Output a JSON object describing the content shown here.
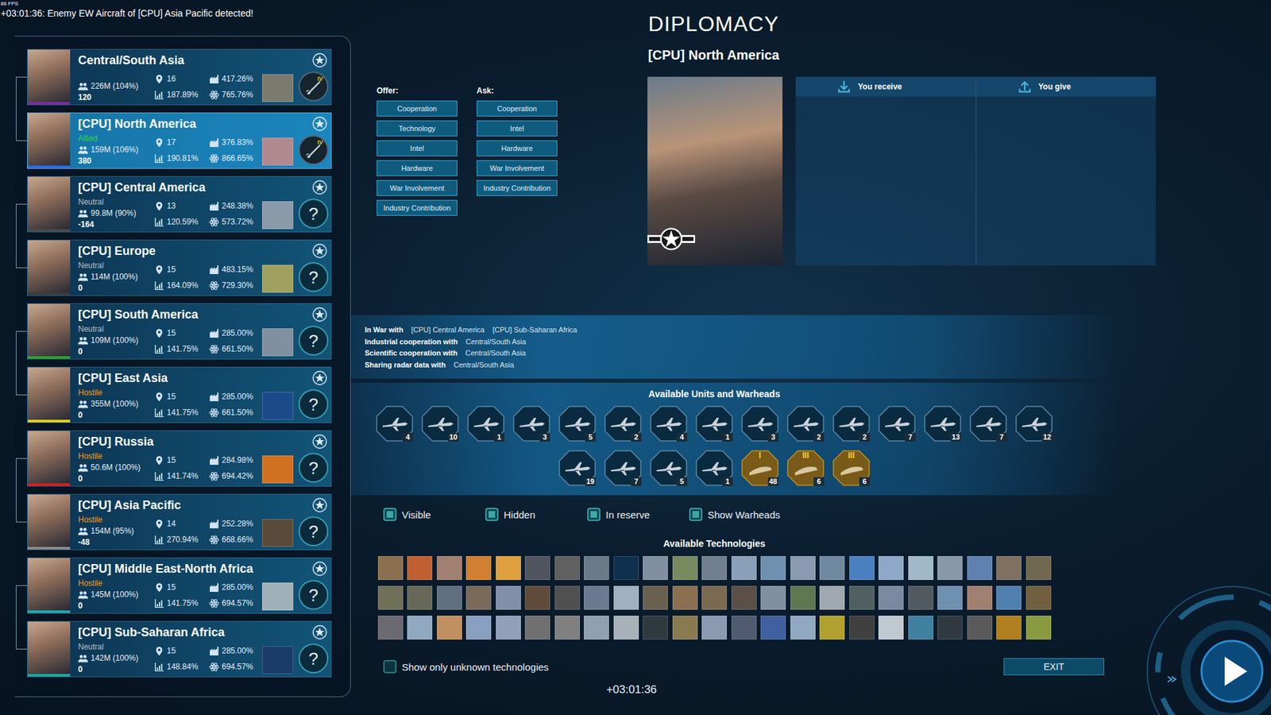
{
  "hud": {
    "fps": "86 FPS",
    "log": "+03:01:36: Enemy EW Aircraft of [CPU] Asia Pacific detected!"
  },
  "title": "DIPLOMACY",
  "countries": [
    {
      "name": "Central/South Asia",
      "status": null,
      "status_color": null,
      "population": "226M (104%)",
      "score": "120",
      "regions": "16",
      "growth": "187.89%",
      "industry": "417.26%",
      "research": "765.76%",
      "selected": false,
      "color": "#7a2c9e",
      "thumb_color": "#7a7a70",
      "badge": {
        "kind": "rank",
        "text": "IV"
      }
    },
    {
      "name": "[CPU] North America",
      "status": "Allied",
      "status_color": "#3ad24a",
      "population": "159M (106%)",
      "score": "380",
      "regions": "17",
      "growth": "190.81%",
      "industry": "376.83%",
      "research": "866.65%",
      "selected": true,
      "color": "#2a6ae0",
      "thumb_color": "#b08890",
      "badge": {
        "kind": "rank",
        "text": "IV"
      }
    },
    {
      "name": "[CPU] Central America",
      "status": "Neutral",
      "status_color": "#b4c0c8",
      "population": "99.8M (90%)",
      "score": "-164",
      "regions": "13",
      "growth": "120.59%",
      "industry": "248.38%",
      "research": "573.72%",
      "selected": false,
      "color": "#4a4a4a",
      "thumb_color": "#8a9aa8",
      "badge": {
        "kind": "unknown",
        "text": "?"
      }
    },
    {
      "name": "[CPU] Europe",
      "status": "Neutral",
      "status_color": "#b4c0c8",
      "population": "114M (100%)",
      "score": "0",
      "regions": "15",
      "growth": "164.09%",
      "industry": "483.15%",
      "research": "729.30%",
      "selected": false,
      "color": "#3c3c3c",
      "thumb_color": "#a0a060",
      "badge": {
        "kind": "unknown",
        "text": "?"
      }
    },
    {
      "name": "[CPU] South America",
      "status": "Neutral",
      "status_color": "#b4c0c8",
      "population": "109M (100%)",
      "score": "0",
      "regions": "15",
      "growth": "141.75%",
      "industry": "285.00%",
      "research": "661.50%",
      "selected": false,
      "color": "#2fa02f",
      "thumb_color": "#8090a0",
      "badge": {
        "kind": "unknown",
        "text": "?"
      }
    },
    {
      "name": "[CPU] East Asia",
      "status": "Hostile",
      "status_color": "#f0a020",
      "population": "355M (100%)",
      "score": "0",
      "regions": "15",
      "growth": "141.75%",
      "industry": "285.00%",
      "research": "661.50%",
      "selected": false,
      "color": "#e0d020",
      "thumb_color": "#1a4a8a",
      "badge": {
        "kind": "unknown",
        "text": "?"
      }
    },
    {
      "name": "[CPU] Russia",
      "status": "Hostile",
      "status_color": "#f0a020",
      "population": "50.6M (100%)",
      "score": "0",
      "regions": "15",
      "growth": "141.74%",
      "industry": "284.98%",
      "research": "694.42%",
      "selected": false,
      "color": "#d02020",
      "thumb_color": "#d07020",
      "badge": {
        "kind": "unknown",
        "text": "?"
      }
    },
    {
      "name": "[CPU] Asia Pacific",
      "status": "Hostile",
      "status_color": "#f0a020",
      "population": "154M (95%)",
      "score": "-48",
      "regions": "14",
      "growth": "270.94%",
      "industry": "252.28%",
      "research": "668.66%",
      "selected": false,
      "color": "#8a8a8a",
      "thumb_color": "#5a4a3a",
      "badge": {
        "kind": "unknown",
        "text": "?"
      }
    },
    {
      "name": "[CPU] Middle East-North Africa",
      "status": "Hostile",
      "status_color": "#f0a020",
      "population": "145M (100%)",
      "score": "0",
      "regions": "15",
      "growth": "141.75%",
      "industry": "285.00%",
      "research": "694.57%",
      "selected": false,
      "color": "#20a8b0",
      "thumb_color": "#a0b0b8",
      "badge": {
        "kind": "unknown",
        "text": "?"
      }
    },
    {
      "name": "[CPU] Sub-Saharan Africa",
      "status": "Neutral",
      "status_color": "#b4c0c8",
      "population": "142M (100%)",
      "score": "0",
      "regions": "15",
      "growth": "148.84%",
      "industry": "285.00%",
      "research": "694.57%",
      "selected": false,
      "color": "#1aa6a0",
      "thumb_color": "#1a3a6a",
      "badge": {
        "kind": "unknown",
        "text": "?"
      }
    }
  ],
  "selected_country": {
    "name": "[CPU] North America"
  },
  "offer": {
    "label": "Offer:",
    "buttons": [
      "Cooperation",
      "Technology",
      "Intel",
      "Hardware",
      "War Involvement",
      "Industry Contribution"
    ]
  },
  "ask": {
    "label": "Ask:",
    "buttons": [
      "Cooperation",
      "Intel",
      "Hardware",
      "War Involvement",
      "Industry Contribution"
    ]
  },
  "trade": {
    "receive": "You receive",
    "give": "You give"
  },
  "relations": [
    {
      "label": "In War with",
      "values": [
        "[CPU] Central America",
        "[CPU] Sub-Saharan Africa"
      ]
    },
    {
      "label": "Industrial cooperation with",
      "values": [
        "Central/South Asia"
      ]
    },
    {
      "label": "Scientific cooperation with",
      "values": [
        "Central/South Asia"
      ]
    },
    {
      "label": "Sharing radar data with",
      "values": [
        "Central/South Asia"
      ]
    }
  ],
  "units": {
    "title": "Available Units and Warheads",
    "items": [
      {
        "kind": "unit",
        "tier": null,
        "count": "4"
      },
      {
        "kind": "unit",
        "tier": null,
        "count": "10"
      },
      {
        "kind": "unit",
        "tier": null,
        "count": "1"
      },
      {
        "kind": "unit",
        "tier": null,
        "count": "3"
      },
      {
        "kind": "unit",
        "tier": null,
        "count": "5"
      },
      {
        "kind": "unit",
        "tier": null,
        "count": "2"
      },
      {
        "kind": "unit",
        "tier": null,
        "count": "4"
      },
      {
        "kind": "unit",
        "tier": null,
        "count": "1"
      },
      {
        "kind": "unit",
        "tier": null,
        "count": "3"
      },
      {
        "kind": "unit",
        "tier": null,
        "count": "2"
      },
      {
        "kind": "unit",
        "tier": null,
        "count": "2"
      },
      {
        "kind": "unit",
        "tier": null,
        "count": "7"
      },
      {
        "kind": "unit",
        "tier": null,
        "count": "13"
      },
      {
        "kind": "unit",
        "tier": null,
        "count": "7"
      },
      {
        "kind": "unit",
        "tier": null,
        "count": "12"
      },
      {
        "kind": "unit",
        "tier": null,
        "count": "19"
      },
      {
        "kind": "unit",
        "tier": null,
        "count": "7"
      },
      {
        "kind": "unit",
        "tier": null,
        "count": "5"
      },
      {
        "kind": "unit",
        "tier": null,
        "count": "1"
      },
      {
        "kind": "warhead",
        "tier": "I",
        "count": "48"
      },
      {
        "kind": "warhead",
        "tier": "III",
        "count": "6"
      },
      {
        "kind": "warhead",
        "tier": "III",
        "count": "6"
      }
    ]
  },
  "filters": [
    {
      "label": "Visible",
      "checked": true
    },
    {
      "label": "Hidden",
      "checked": true
    },
    {
      "label": "In reserve",
      "checked": true
    },
    {
      "label": "Show Warheads",
      "checked": true
    }
  ],
  "technologies": {
    "title": "Available Technologies",
    "items": [
      "#8a7050",
      "#c06030",
      "#a08070",
      "#d08030",
      "#e0a040",
      "#505560",
      "#606060",
      "#6a7a88",
      "#103050",
      "#8090a0",
      "#7a8a60",
      "#708090",
      "#8aa0b8",
      "#7090b0",
      "#8a9ab0",
      "#7088a0",
      "#4a80c0",
      "#90a8c8",
      "#a0b8c8",
      "#8898a8",
      "#6080b0",
      "#807060",
      "#706850",
      "#707058",
      "#686858",
      "#607080",
      "#7a6a5a",
      "#8090a8",
      "#604a3a",
      "#505050",
      "#6a7a90",
      "#a0b0c0",
      "#6a6050",
      "#8a7050",
      "#7a6a50",
      "#5a5048",
      "#8090a0",
      "#607850",
      "#a0a8b0",
      "#506060",
      "#7a8aa0",
      "#505a60",
      "#7090b0",
      "#a08070",
      "#5080b0",
      "#706040",
      "#6a6a70",
      "#90a8c0",
      "#c09060",
      "#8aa0c0",
      "#90a0b8",
      "#707070",
      "#808080",
      "#90a0b0",
      "#a8b0b8",
      "#303840",
      "#8a7a50",
      "#8a9ab0",
      "#505a70",
      "#4060a0",
      "#90a8c0",
      "#b0a030",
      "#404040",
      "#c0c8d0",
      "#4080a0",
      "#303840",
      "#5a5a5a",
      "#b08020",
      "#8a9a40"
    ]
  },
  "unknown_filter": {
    "label": "Show only unknown technologies",
    "checked": false
  },
  "exit": "EXIT",
  "clock": "+03:01:36"
}
